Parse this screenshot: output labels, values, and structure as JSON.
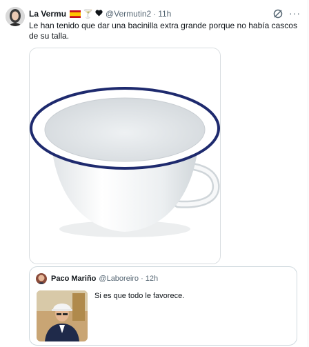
{
  "tweet": {
    "author_name": "La Vermu",
    "emoji_glyph": "🍸",
    "handle": "@Vermutin2",
    "separator": "·",
    "time": "11h",
    "text": "Le han tenido que dar una bacinilla extra grande porque no había cascos de su talla.",
    "icons": [
      "spain-flag-icon",
      "cocktail-icon",
      "heart-icon",
      "grok-icon",
      "more-icon"
    ],
    "more_label": "···"
  },
  "quoted": {
    "author_name": "Paco Mariño",
    "handle": "@Laboreiro",
    "separator": "·",
    "time": "12h",
    "text": "Si es que todo le favorece."
  },
  "colors": {
    "text": "#0f1419",
    "secondary": "#536471",
    "border": "#cfd9de",
    "enamel_rim": "#1e2a6e"
  }
}
